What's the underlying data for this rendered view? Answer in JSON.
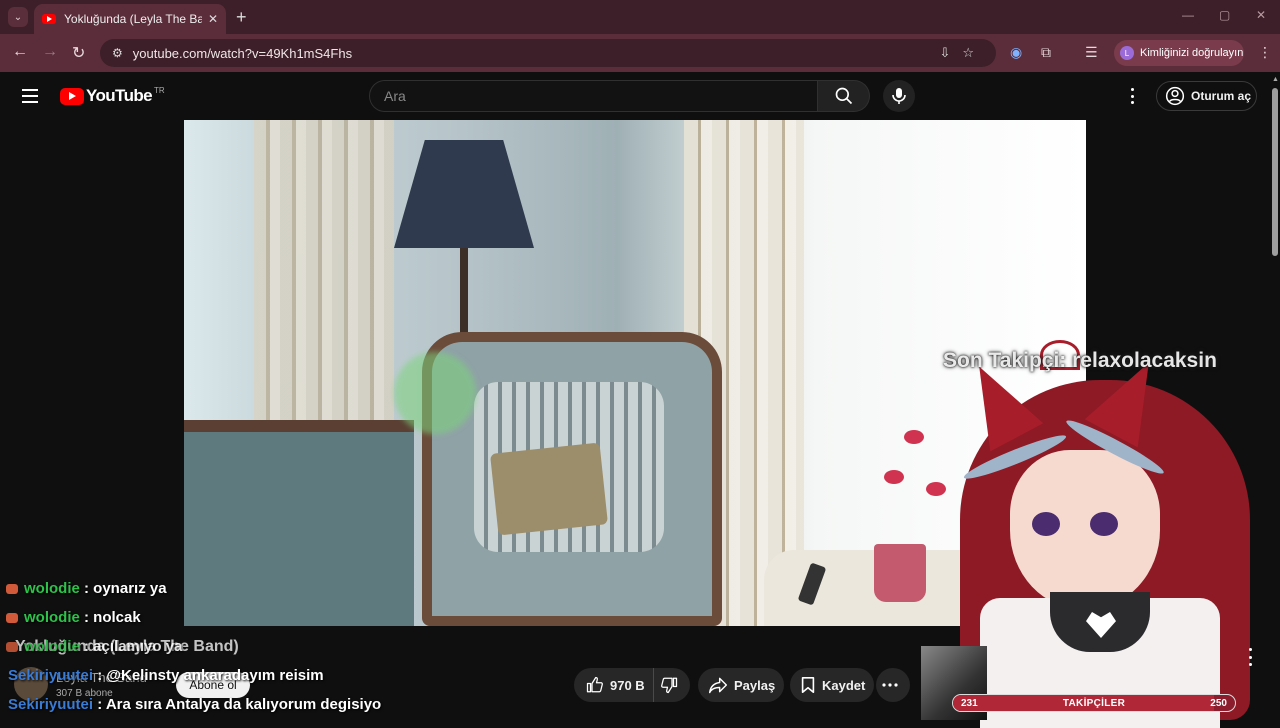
{
  "browser": {
    "tab_title": "Yokluğunda (Leyla The Band) - YouTube",
    "tab_close": "✕",
    "new_tab": "+",
    "url": "youtube.com/watch?v=49Kh1mS4Fhs",
    "profile_initial": "L",
    "profile_label": "Kimliğinizi doğrulayın",
    "controls": {
      "back": "←",
      "forward": "→",
      "reload": "↻",
      "minimize": "—",
      "maximize": "▢",
      "close": "✕",
      "dropdown": "⌄",
      "menu": "⋮"
    }
  },
  "youtube": {
    "logo_text": "YouTube",
    "region": "TR",
    "search_placeholder": "Ara",
    "signin_label": "Oturum aç"
  },
  "overlay": {
    "last_follower": "Son Takipçi: relaxolacaksin"
  },
  "chat": [
    {
      "user": "wolodie",
      "message": ": oynarız ya",
      "badge": true
    },
    {
      "user": "wolodie",
      "message": ": nolcak",
      "badge": true
    },
    {
      "user": "wolodie",
      "message": ": açılamıyo ya",
      "badge": true
    },
    {
      "user": "Sekiriyuutei",
      "message": ": @Kelinsty ankaradayım reisim",
      "badge": false
    },
    {
      "user": "Sekiriyuutei",
      "message": ": Ara sıra Antalya da kalıyorum degisiyo",
      "badge": false
    }
  ],
  "video": {
    "title": "Yokluğunda (Leyla The Band)",
    "channel": "Leyla The Band",
    "subscribers": "307 B abone",
    "subscribe_label": "Abone ol",
    "likes": "970 B",
    "share_label": "Paylaş",
    "save_label": "Kaydet"
  },
  "followers_goal": {
    "label": "TAKİPÇİLER",
    "current": "231",
    "target": "250",
    "progress": 0.924
  }
}
